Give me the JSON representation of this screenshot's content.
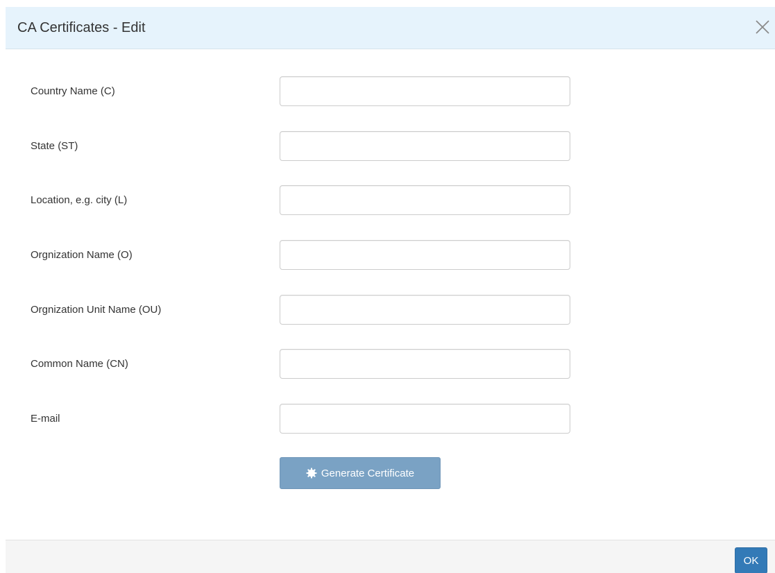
{
  "dialog": {
    "title": "CA Certificates - Edit",
    "close_icon": "close-icon"
  },
  "form": {
    "fields": [
      {
        "label": "Country Name (C)",
        "value": "",
        "placeholder": ""
      },
      {
        "label": "State (ST)",
        "value": "",
        "placeholder": ""
      },
      {
        "label": "Location, e.g. city (L)",
        "value": "",
        "placeholder": ""
      },
      {
        "label": "Orgnization Name (O)",
        "value": "",
        "placeholder": ""
      },
      {
        "label": "Orgnization Unit Name (OU)",
        "value": "",
        "placeholder": ""
      },
      {
        "label": "Common Name (CN)",
        "value": "",
        "placeholder": ""
      },
      {
        "label": "E-mail",
        "value": "",
        "placeholder": ""
      }
    ],
    "generate_button": {
      "label": "Generate Certificate",
      "icon": "gear-icon"
    }
  },
  "footer": {
    "ok_label": "OK"
  },
  "colors": {
    "header_bg": "#e6f3fc",
    "generate_button_bg": "#7aa2c4",
    "ok_button_bg": "#337ab7",
    "footer_bg": "#f5f5f5"
  }
}
